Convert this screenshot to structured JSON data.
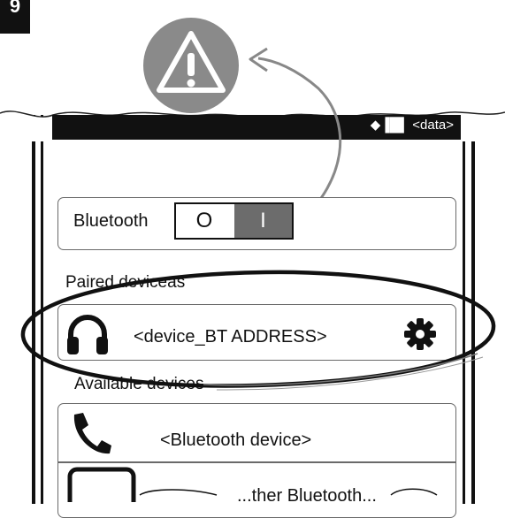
{
  "step_badge": "9",
  "status_bar": {
    "text": "◆▐█▌ <data>"
  },
  "bluetooth": {
    "label": "Bluetooth",
    "toggle_off": "O",
    "toggle_on": "I"
  },
  "sections": {
    "paired": "Paired deviceas",
    "available": "Available devices"
  },
  "paired_device": {
    "name": "<device_BT ADDRESS>",
    "icon": "headphones-icon",
    "settings_icon": "gear-icon"
  },
  "available_devices": [
    {
      "name": "<Bluetooth device>",
      "icon": "phone-icon"
    },
    {
      "name": "...ther Bluetooth...",
      "icon": "device-icon"
    }
  ],
  "warning": {
    "icon": "warning-icon"
  },
  "colors": {
    "warning_circle": "#8a8a8a",
    "toggle_on": "#6c6c6c",
    "status_bar": "#111111"
  }
}
